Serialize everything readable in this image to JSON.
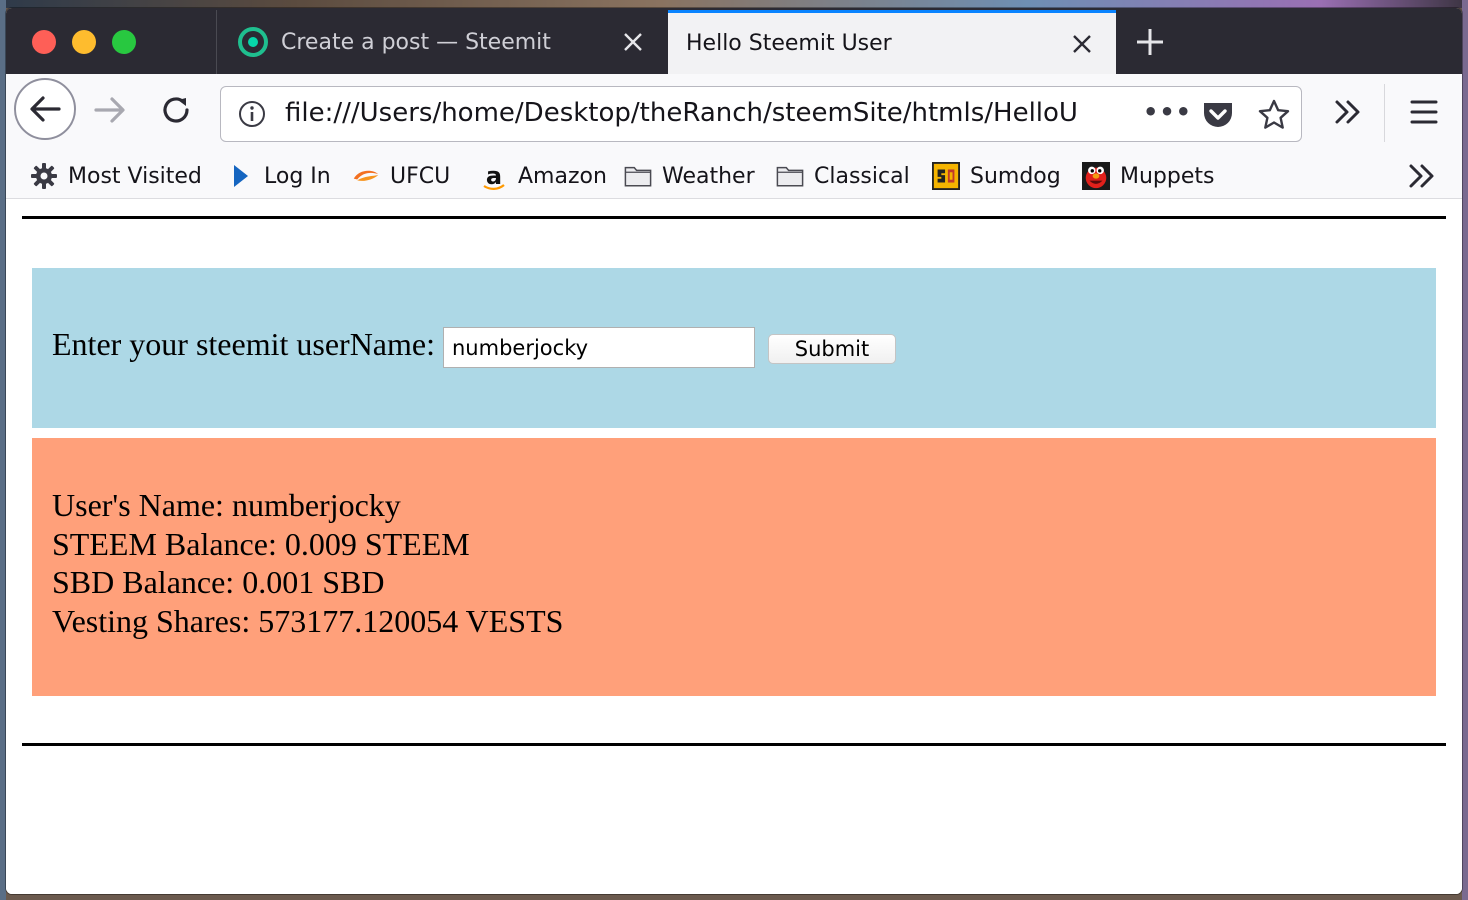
{
  "browser": {
    "tabs": [
      {
        "title": "Create a post — Steemit",
        "active": false,
        "favicon": "steemit-icon"
      },
      {
        "title": "Hello Steemit User",
        "active": true
      }
    ],
    "url": "file:///Users/home/Desktop/theRanch/steemSite/htmls/HelloUs",
    "bookmarks": [
      {
        "label": "Most Visited",
        "icon": "gear-icon"
      },
      {
        "label": "Log In",
        "icon": "play-triangle-icon"
      },
      {
        "label": "UFCU",
        "icon": "ufcu-swoosh-icon"
      },
      {
        "label": "Amazon",
        "icon": "amazon-a-icon"
      },
      {
        "label": "Weather",
        "icon": "folder-icon"
      },
      {
        "label": "Classical",
        "icon": "folder-icon"
      },
      {
        "label": "Sumdog",
        "icon": "sumdog-icon"
      },
      {
        "label": "Muppets",
        "icon": "elmo-icon"
      }
    ]
  },
  "page": {
    "input_label": "Enter your steemit userName:",
    "input_value": "numberjocky",
    "submit_label": "Submit",
    "result_lines": [
      "User's Name: numberjocky",
      "STEEM Balance: 0.009 STEEM",
      "SBD Balance: 0.001 SBD",
      "Vesting Shares: 573177.120054 VESTS"
    ]
  },
  "colors": {
    "input_panel_bg": "#add8e6",
    "result_panel_bg": "#ffa07a",
    "tabbar_bg": "#2b2a33",
    "active_tab_accent": "#0a84ff"
  }
}
